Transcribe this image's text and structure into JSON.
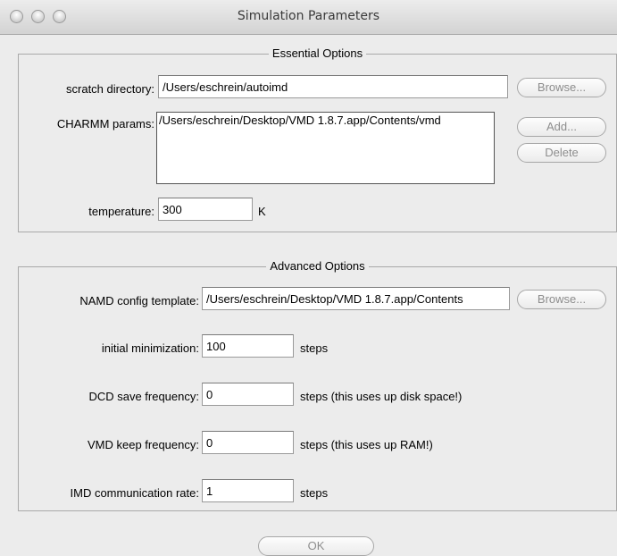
{
  "window": {
    "title": "Simulation Parameters"
  },
  "essential": {
    "legend": "Essential Options",
    "scratch_dir_label": "scratch directory:",
    "scratch_dir_value": "/Users/eschrein/autoimd",
    "scratch_browse": "Browse...",
    "charmm_label": "CHARMM params:",
    "charmm_items": [
      "/Users/eschrein/Desktop/VMD 1.8.7.app/Contents/vmd"
    ],
    "add_label": "Add...",
    "delete_label": "Delete",
    "temperature_label": "temperature:",
    "temperature_value": "300",
    "temperature_unit": "K"
  },
  "advanced": {
    "legend": "Advanced Options",
    "namd_label": "NAMD config template:",
    "namd_value": "/Users/eschrein/Desktop/VMD 1.8.7.app/Contents",
    "namd_browse": "Browse...",
    "min_label": "initial minimization:",
    "min_value": "100",
    "min_unit": "steps",
    "dcd_label": "DCD save frequency:",
    "dcd_value": "0",
    "dcd_unit": "steps (this uses up disk space!)",
    "keep_label": "VMD keep frequency:",
    "keep_value": "0",
    "keep_unit": "steps (this uses up RAM!)",
    "imd_label": "IMD communication rate:",
    "imd_value": "1",
    "imd_unit": "steps"
  },
  "ok_label": "OK"
}
